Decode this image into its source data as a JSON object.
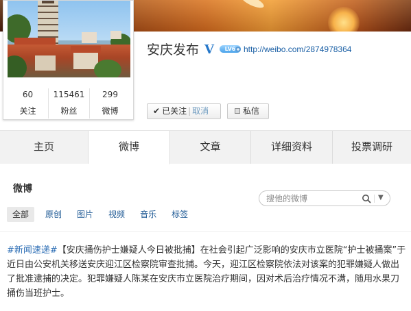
{
  "profile": {
    "name": "安庆发布",
    "level_badge": "LV6",
    "url": "http://weibo.com/2874978364",
    "stats": [
      {
        "value": "60",
        "label": "关注"
      },
      {
        "value": "115461",
        "label": "粉丝"
      },
      {
        "value": "299",
        "label": "微博"
      }
    ],
    "follow_button": {
      "status": "已关注",
      "separator": "|",
      "cancel": "取消"
    },
    "message_button": "私信"
  },
  "tabs": [
    {
      "label": "主页",
      "active": false
    },
    {
      "label": "微博",
      "active": true
    },
    {
      "label": "文章",
      "active": false
    },
    {
      "label": "详细资料",
      "active": false
    },
    {
      "label": "投票调研",
      "active": false
    }
  ],
  "feed": {
    "title": "微博",
    "search_placeholder": "搜他的微博",
    "filters": [
      "全部",
      "原创",
      "图片",
      "视频",
      "音乐",
      "标签"
    ]
  },
  "post": {
    "hashtag": "#新闻速递#",
    "text": "【安庆捅伤护士嫌疑人今日被批捕】在社会引起广泛影响的安庆市立医院“护士被捅案”于近日由公安机关移送安庆迎江区检察院审查批捕。今天，迎江区检察院依法对该案的犯罪嫌疑人做出了批准逮捕的决定。犯罪嫌疑人陈某在安庆市立医院治疗期间，因对术后治疗情况不满，随用水果刀捅伤当班护士。"
  },
  "colors": {
    "link": "#1a5fa5",
    "verified": "#2577c9",
    "tab_bg": "#f2f2f2",
    "hashtag": "#2d6eb5"
  }
}
